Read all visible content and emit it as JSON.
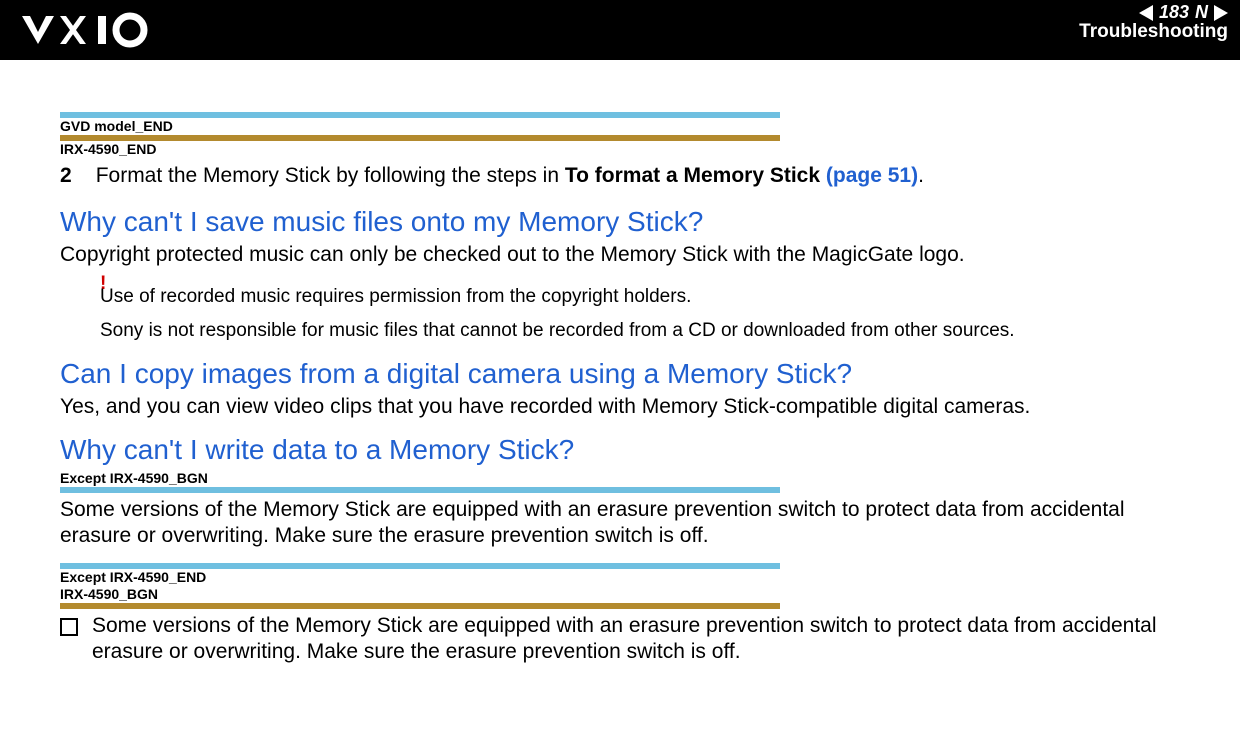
{
  "header": {
    "page_number": "183",
    "section": "Troubleshooting",
    "n_marker": "N"
  },
  "models": {
    "gvd_end": "GVD model_END",
    "irx_end": "IRX-4590_END",
    "except_irx_bgn": "Except IRX-4590_BGN",
    "except_irx_end": "Except IRX-4590_END",
    "irx_bgn": "IRX-4590_BGN"
  },
  "step2": {
    "number": "2",
    "prefix": "Format the Memory Stick by following the steps in ",
    "bold": "To format a Memory Stick ",
    "link": "(page 51)",
    "suffix": "."
  },
  "q1": {
    "heading": "Why can't I save music files onto my Memory Stick?",
    "body": "Copyright protected music can only be checked out to the Memory Stick with the MagicGate logo.",
    "warning_mark": "!",
    "warning_line1": "Use of recorded music requires permission from the copyright holders.",
    "warning_line2": "Sony is not responsible for music files that cannot be recorded from a CD or downloaded from other sources."
  },
  "q2": {
    "heading": "Can I copy images from a digital camera using a Memory Stick?",
    "body": "Yes, and you can view video clips that you have recorded with Memory Stick-compatible digital cameras."
  },
  "q3": {
    "heading": "Why can't I write data to a Memory Stick?",
    "body1": "Some versions of the Memory Stick are equipped with an erasure prevention switch to protect data from accidental erasure or overwriting. Make sure the erasure prevention switch is off.",
    "bullet": "Some versions of the Memory Stick are equipped with an erasure prevention switch to protect data from accidental erasure or overwriting. Make sure the erasure prevention switch is off."
  }
}
